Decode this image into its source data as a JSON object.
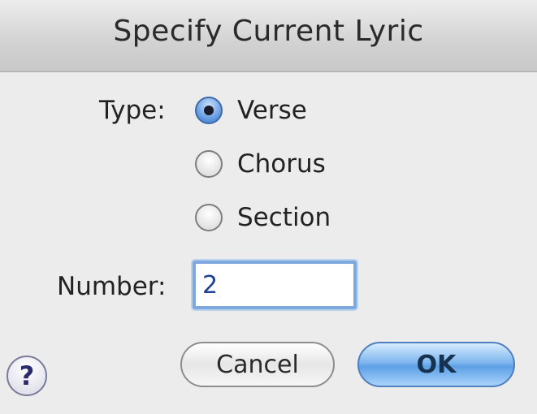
{
  "dialog": {
    "title": "Specify Current Lyric"
  },
  "type": {
    "label": "Type:",
    "options": [
      {
        "label": "Verse",
        "checked": true
      },
      {
        "label": "Chorus",
        "checked": false
      },
      {
        "label": "Section",
        "checked": false
      }
    ]
  },
  "number": {
    "label": "Number:",
    "value": "2"
  },
  "buttons": {
    "help_glyph": "?",
    "cancel_label": "Cancel",
    "ok_label": "OK"
  },
  "icons": {
    "help": "question-mark-icon"
  },
  "colors": {
    "default_button": "#5ea0e6",
    "focus_ring": "#7fa8dc",
    "selected_radio": "#5b95dd"
  }
}
